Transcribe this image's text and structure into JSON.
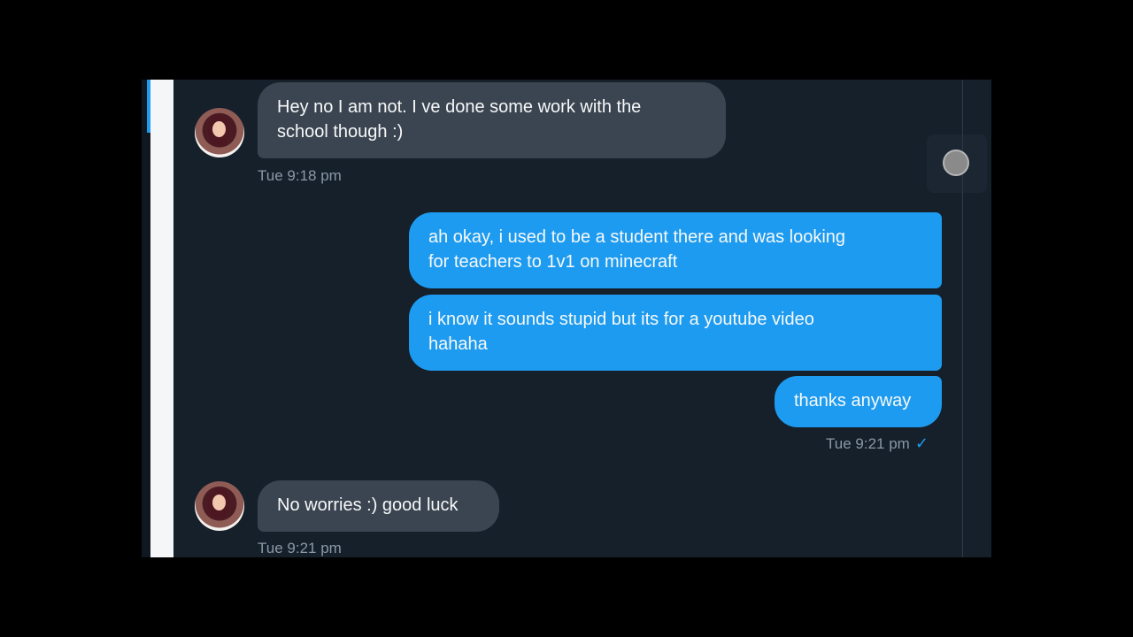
{
  "conversation": {
    "messages": [
      {
        "direction": "incoming",
        "lines": [
          "Hey no I am not. I ve done some work with the",
          "school though :)"
        ],
        "timestamp": "Tue 9:18 pm"
      },
      {
        "direction": "outgoing",
        "lines": [
          "ah okay, i used to be a student there and was looking",
          "for teachers to 1v1 on minecraft"
        ]
      },
      {
        "direction": "outgoing",
        "lines": [
          "i know it sounds stupid but its for a youtube video",
          "hahaha"
        ]
      },
      {
        "direction": "outgoing",
        "lines": [
          "thanks anyway"
        ],
        "timestamp": "Tue 9:21 pm",
        "read_receipt_icon": "checkmark-icon"
      },
      {
        "direction": "incoming",
        "lines": [
          "No worries :) good luck"
        ],
        "timestamp": "Tue 9:21 pm"
      }
    ]
  },
  "ui": {
    "colors": {
      "background": "#15202b",
      "incoming_bubble": "#3a4551",
      "outgoing_bubble": "#1d9bf0",
      "timestamp": "#8b98a5",
      "receipt": "#1d9bf0"
    },
    "icons": {
      "avatar": "profile-avatar",
      "scroll_control": "scroll-knob-icon",
      "receipt": "checkmark-icon"
    }
  }
}
